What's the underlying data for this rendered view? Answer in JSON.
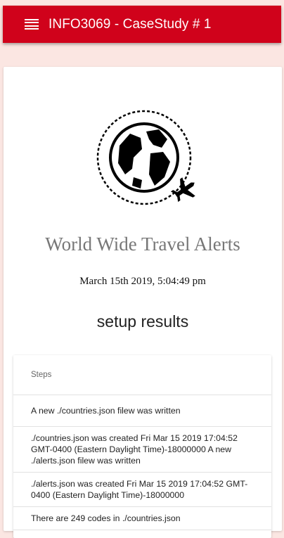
{
  "appbar": {
    "title": "INFO3069 - CaseStudy # 1",
    "color": "#d0021b"
  },
  "main": {
    "headline": "World Wide Travel Alerts",
    "timestamp": "March 15th 2019, 5:04:49 pm",
    "section_title": "setup results"
  },
  "results": {
    "header": "Steps",
    "items": [
      "A new ./countries.json filew was written",
      "./countries.json was created Fri Mar 15 2019 17:04:52 GMT-0400 (Eastern Daylight Time)-18000000 A new ./alerts.json filew was written",
      "./alerts.json was created Fri Mar 15 2019 17:04:52 GMT-0400 (Eastern Daylight Time)-18000000",
      "There are 249 codes in ./countries.json"
    ]
  },
  "icons": {
    "menu": "menu-icon",
    "logo": "globe-airplane-icon"
  },
  "colors": {
    "background": "#fbe6e2",
    "primary": "#d0021b"
  }
}
